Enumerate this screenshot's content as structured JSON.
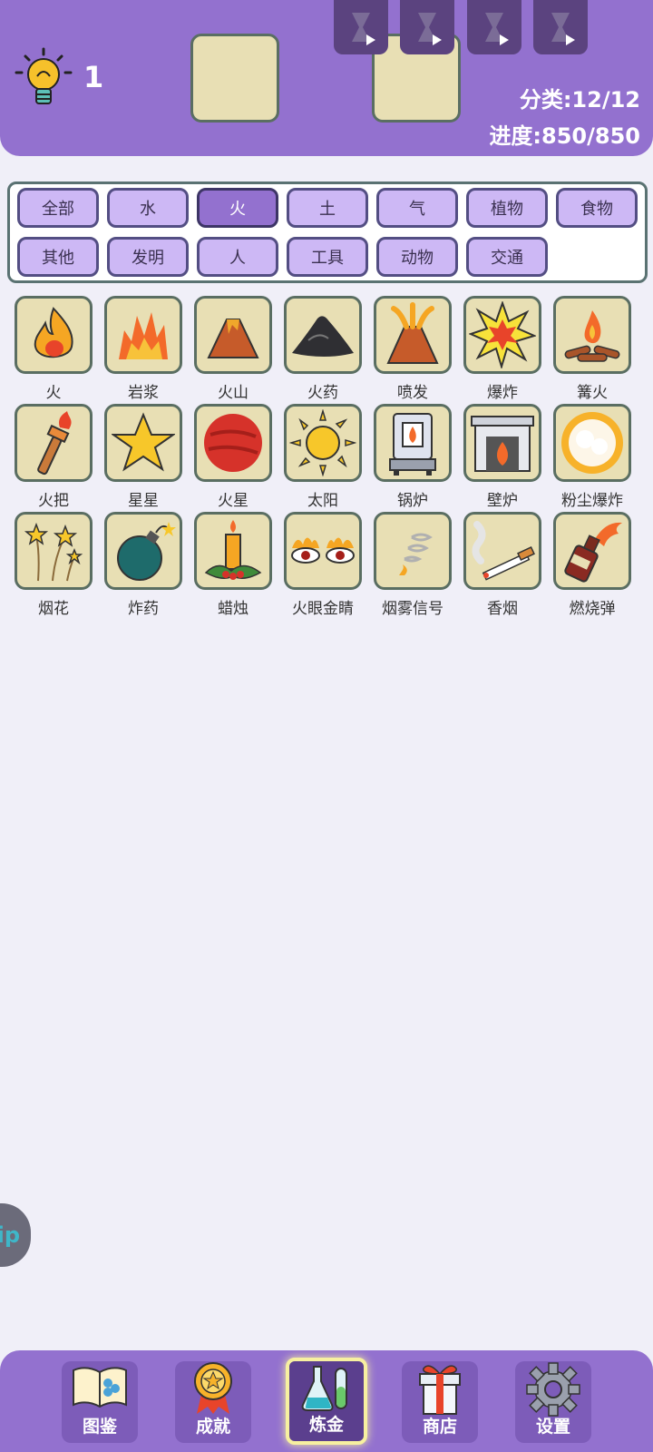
{
  "header": {
    "hint_count": "1",
    "category_stat": "分类:12/12",
    "progress_stat": "进度:850/850"
  },
  "tabs": [
    "全部",
    "水",
    "火",
    "土",
    "气",
    "植物",
    "食物",
    "其他",
    "发明",
    "人",
    "工具",
    "动物",
    "交通"
  ],
  "active_tab": "火",
  "items": [
    {
      "label": "火",
      "icon": "fire-icon"
    },
    {
      "label": "岩浆",
      "icon": "lava-icon"
    },
    {
      "label": "火山",
      "icon": "volcano-icon"
    },
    {
      "label": "火药",
      "icon": "gunpowder-icon"
    },
    {
      "label": "喷发",
      "icon": "eruption-icon"
    },
    {
      "label": "爆炸",
      "icon": "explosion-icon"
    },
    {
      "label": "篝火",
      "icon": "campfire-icon"
    },
    {
      "label": "火把",
      "icon": "torch-icon"
    },
    {
      "label": "星星",
      "icon": "star-icon"
    },
    {
      "label": "火星",
      "icon": "mars-icon"
    },
    {
      "label": "太阳",
      "icon": "sun-icon"
    },
    {
      "label": "锅炉",
      "icon": "boiler-icon"
    },
    {
      "label": "壁炉",
      "icon": "fireplace-icon"
    },
    {
      "label": "粉尘爆炸",
      "icon": "dust-explosion-icon"
    },
    {
      "label": "烟花",
      "icon": "fireworks-icon"
    },
    {
      "label": "炸药",
      "icon": "bomb-icon"
    },
    {
      "label": "蜡烛",
      "icon": "candle-icon"
    },
    {
      "label": "火眼金睛",
      "icon": "fiery-eyes-icon"
    },
    {
      "label": "烟雾信号",
      "icon": "smoke-signal-icon"
    },
    {
      "label": "香烟",
      "icon": "cigarette-icon"
    },
    {
      "label": "燃烧弹",
      "icon": "molotov-icon"
    }
  ],
  "side_button": "ip",
  "nav": [
    {
      "label": "图鉴",
      "icon": "book-icon"
    },
    {
      "label": "成就",
      "icon": "medal-icon"
    },
    {
      "label": "炼金",
      "icon": "flask-icon"
    },
    {
      "label": "商店",
      "icon": "gift-icon"
    },
    {
      "label": "设置",
      "icon": "gear-icon"
    }
  ],
  "active_nav": "炼金"
}
